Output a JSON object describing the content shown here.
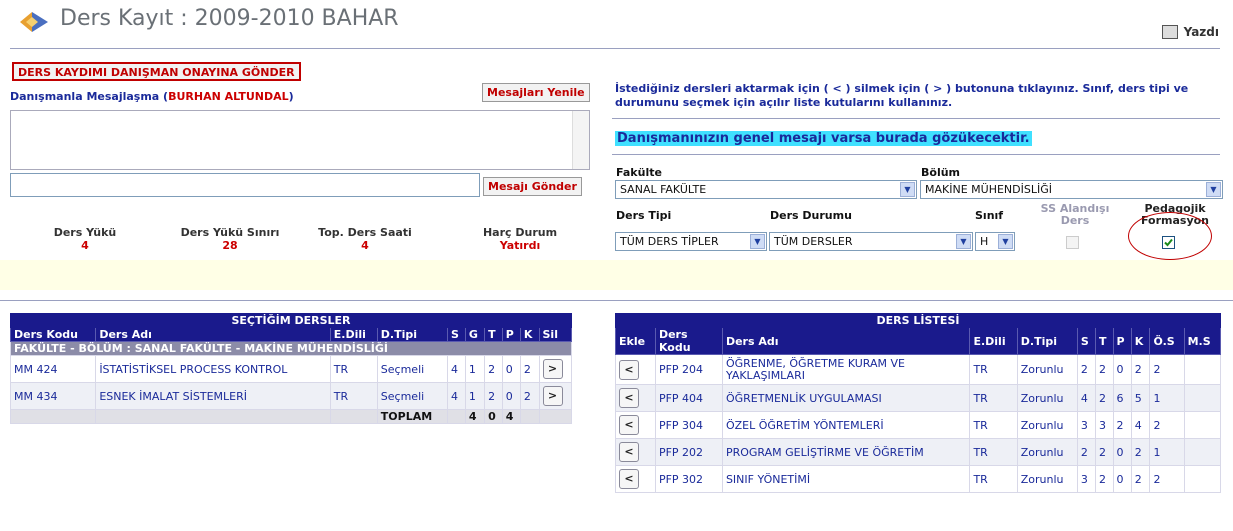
{
  "header": {
    "title": "Ders Kayıt : 2009-2010 BAHAR",
    "print_label": "Yazdı"
  },
  "left": {
    "send_to_advisor": "DERS KAYDIMI DANIŞMAN ONAYINA GÖNDER",
    "messaging_label": "Danışmanla Mesajlaşma (",
    "advisor_name": "BURHAN ALTUNDAL",
    "messaging_close": ")",
    "refresh_messages": "Mesajları Yenile",
    "send_message": "Mesajı Gönder",
    "stats": [
      {
        "label": "Ders Yükü",
        "value": "4"
      },
      {
        "label": "Ders Yükü Sınırı",
        "value": "28"
      },
      {
        "label": "Top. Ders Saati",
        "value": "4"
      },
      {
        "label": "Harç Durum",
        "value": "Yatırdı"
      }
    ]
  },
  "right": {
    "instructions": "İstediğiniz dersleri aktarmak için ( < ) silmek için ( > ) butonuna tıklayınız. Sınıf, ders tipi ve durumunu seçmek için açılır liste kutularını kullanınız.",
    "advisor_notice": "Danışmanınızın genel mesajı varsa burada gözükecektir.",
    "faculty_label": "Fakülte",
    "faculty_value": "SANAL FAKÜLTE",
    "department_label": "Bölüm",
    "department_value": "MAKİNE MÜHENDİSLİĞİ",
    "course_type_label": "Ders Tipi",
    "course_type_value": "TÜM DERS TİPLER",
    "course_status_label": "Ders Durumu",
    "course_status_value": "TÜM DERSLER",
    "class_label": "Sınıf",
    "class_value": "H",
    "ss_label_1": "SS Alandışı",
    "ss_label_2": "Ders",
    "ped_label_1": "Pedagojik",
    "ped_label_2": "Formasyon"
  },
  "selected": {
    "caption": "SEÇTİĞİM DERSLER",
    "headers": [
      "Ders Kodu",
      "Ders Adı",
      "E.Dili",
      "D.Tipi",
      "S",
      "G",
      "T",
      "P",
      "K",
      "Sil"
    ],
    "group": "FAKÜLTE - BÖLÜM : SANAL FAKÜLTE - MAKİNE MÜHENDİSLİĞİ",
    "rows": [
      {
        "code": "MM 424",
        "name": "İSTATİSTİKSEL PROCESS KONTROL",
        "lang": "TR",
        "type": "Seçmeli",
        "s": "4",
        "g": "1",
        "t": "2",
        "p": "0",
        "k": "2",
        "btn": ">"
      },
      {
        "code": "MM 434",
        "name": "ESNEK İMALAT SİSTEMLERİ",
        "lang": "TR",
        "type": "Seçmeli",
        "s": "4",
        "g": "1",
        "t": "2",
        "p": "0",
        "k": "2",
        "btn": ">"
      }
    ],
    "total_label": "TOPLAM",
    "total_s": "4",
    "total_p": "0",
    "total_k": "4"
  },
  "list": {
    "caption": "DERS LİSTESİ",
    "headers": [
      "Ekle",
      "Ders Kodu",
      "Ders Adı",
      "E.Dili",
      "D.Tipi",
      "S",
      "T",
      "P",
      "K",
      "Ö.S",
      "M.S"
    ],
    "rows": [
      {
        "btn": "<",
        "code": "PFP 204",
        "name1": "ÖĞRENME, ÖĞRETME KURAM VE",
        "name2": "YAKLAŞIMLARI",
        "lang": "TR",
        "type": "Zorunlu",
        "s": "2",
        "t": "2",
        "p": "0",
        "k": "2",
        "os": "2"
      },
      {
        "btn": "<",
        "code": "PFP 404",
        "name1": "ÖĞRETMENLİK UYGULAMASI",
        "name2": "",
        "lang": "TR",
        "type": "Zorunlu",
        "s": "4",
        "t": "2",
        "p": "6",
        "k": "5",
        "os": "1"
      },
      {
        "btn": "<",
        "code": "PFP 304",
        "name1": "ÖZEL ÖĞRETİM YÖNTEMLERİ",
        "name2": "",
        "lang": "TR",
        "type": "Zorunlu",
        "s": "3",
        "t": "3",
        "p": "2",
        "k": "4",
        "os": "2"
      },
      {
        "btn": "<",
        "code": "PFP 202",
        "name1": "PROGRAM GELİŞTİRME VE ÖĞRETİM",
        "name2": "",
        "lang": "TR",
        "type": "Zorunlu",
        "s": "2",
        "t": "2",
        "p": "0",
        "k": "2",
        "os": "1"
      },
      {
        "btn": "<",
        "code": "PFP 302",
        "name1": "SINIF YÖNETİMİ",
        "name2": "",
        "lang": "TR",
        "type": "Zorunlu",
        "s": "3",
        "t": "2",
        "p": "0",
        "k": "2",
        "os": "2"
      }
    ]
  }
}
